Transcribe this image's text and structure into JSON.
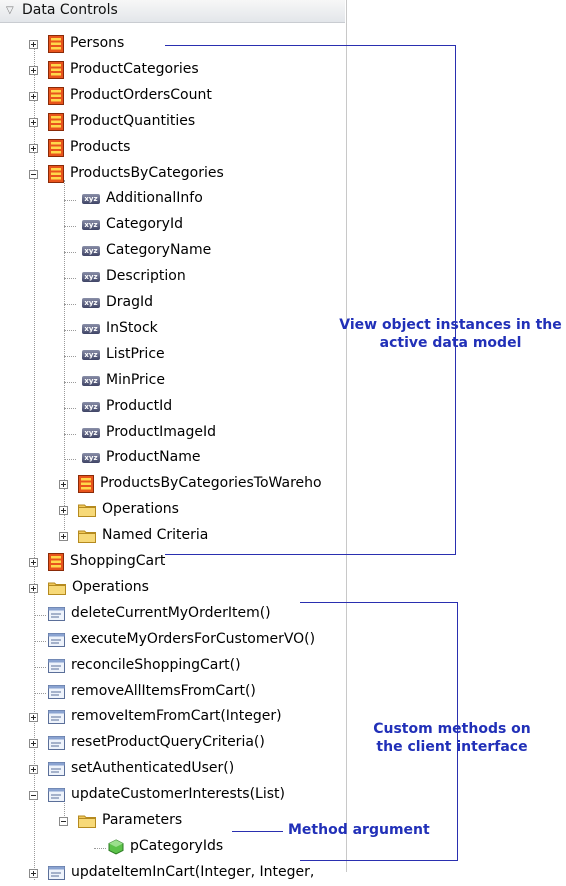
{
  "panel": {
    "title": "Data Controls"
  },
  "tree": {
    "root_items": [
      "Persons",
      "ProductCategories",
      "ProductOrdersCount",
      "ProductQuantities",
      "Products",
      "ProductsByCategories"
    ],
    "attributes": [
      "AdditionalInfo",
      "CategoryId",
      "CategoryName",
      "Description",
      "DragId",
      "InStock",
      "ListPrice",
      "MinPrice",
      "ProductId",
      "ProductImageId",
      "ProductName"
    ],
    "attr_badge": "xyz",
    "nested": [
      "ProductsByCategoriesToWareho",
      "Operations",
      "Named Criteria"
    ],
    "after": [
      "ShoppingCart",
      "Operations"
    ],
    "methods": [
      "deleteCurrentMyOrderItem()",
      "executeMyOrdersForCustomerVO()",
      "reconcileShoppingCart()",
      "removeAllItemsFromCart()",
      "removeItemFromCart(Integer)",
      "resetProductQueryCriteria()",
      "setAuthenticatedUser()",
      "updateCustomerInterests(List)"
    ],
    "parameters_label": "Parameters",
    "parameter": "pCategoryIds",
    "last_method": "updateItemInCart(Integer, Integer,"
  },
  "callouts": {
    "view_objects": [
      "View object instances in the",
      "active data model"
    ],
    "custom_methods": [
      "Custom methods on",
      "the client interface"
    ],
    "method_argument": "Method argument"
  },
  "colors": {
    "callout": "#2130b8",
    "vo_icon": "#e8541c",
    "folder": "#f0c75a"
  }
}
